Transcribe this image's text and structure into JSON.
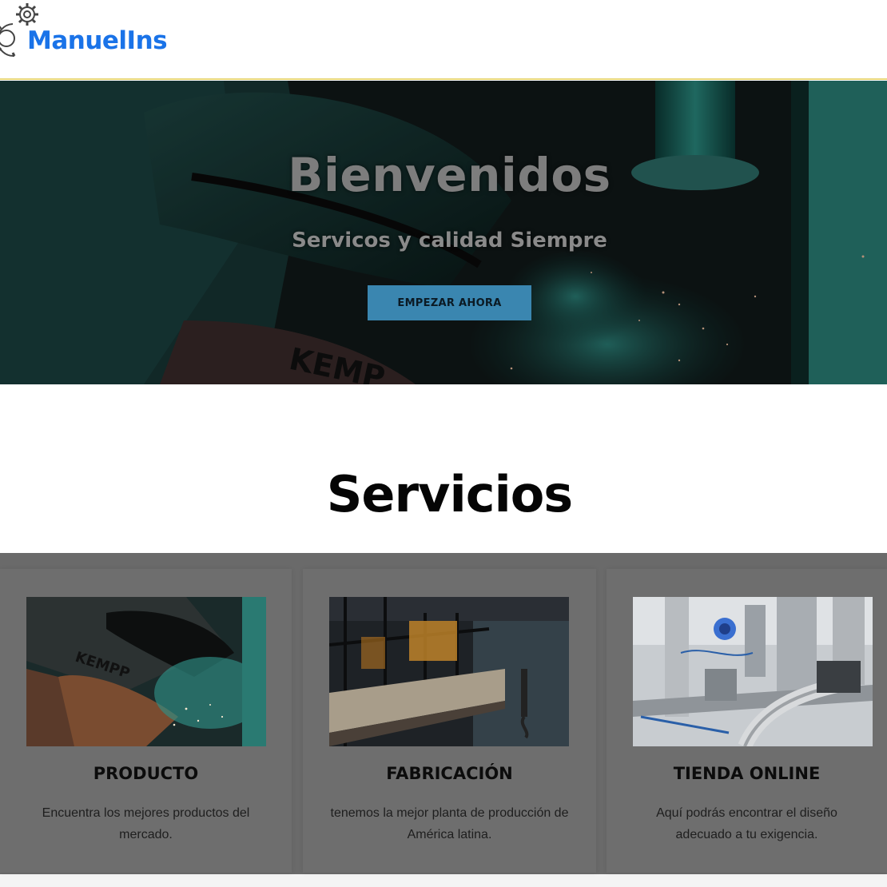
{
  "header": {
    "logo_text": "ManuelIns",
    "logo_icon": "gears-icon",
    "brand_color": "#1a73e8"
  },
  "hero": {
    "title": "Bienvenidos",
    "subtitle": "Servicos y calidad Siempre",
    "button_label": "EMPEZAR AHORA",
    "button_color": "#3a86b0"
  },
  "services": {
    "title": "Servicios",
    "cards": [
      {
        "title": "PRODUCTO",
        "text": "Encuentra los mejores productos del mercado."
      },
      {
        "title": "FABRICACIÓN",
        "text": "tenemos la mejor planta de producción de América latina."
      },
      {
        "title": "TIENDA ONLINE",
        "text": "Aquí podrás encontrar el diseño adecuado a tu exigencia."
      }
    ]
  }
}
